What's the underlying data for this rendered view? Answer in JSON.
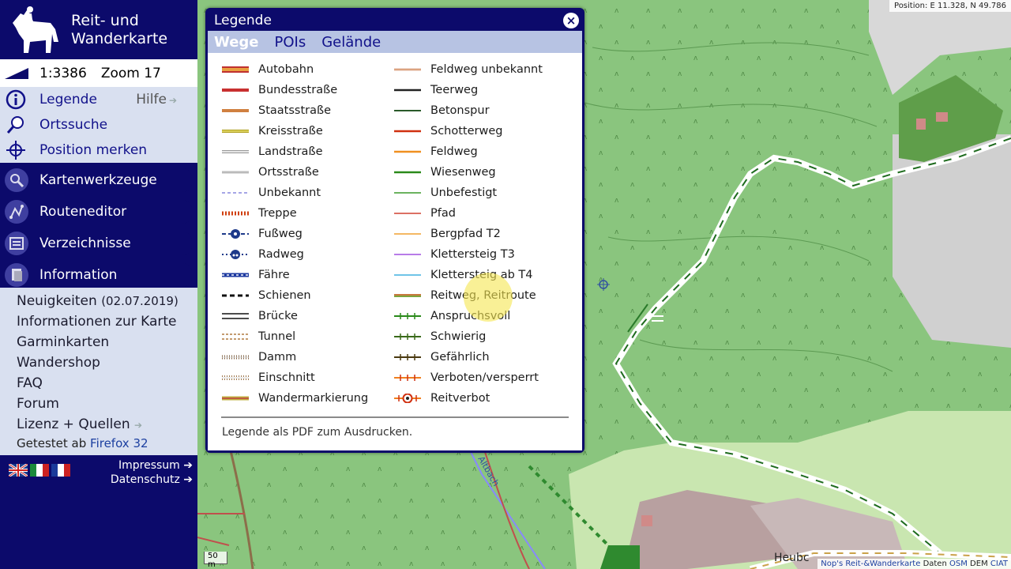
{
  "app": {
    "title_line1": "Reit- und",
    "title_line2": "Wanderkarte"
  },
  "scale": {
    "ratio": "1:3386",
    "zoom": "Zoom 17"
  },
  "menu": {
    "legend": "Legende",
    "help": "Hilfe",
    "search": "Ortssuche",
    "position": "Position merken"
  },
  "sections": {
    "tools": "Kartenwerkzeuge",
    "route": "Routeneditor",
    "dirs": "Verzeichnisse",
    "info": "Information"
  },
  "info_items": {
    "news": "Neuigkeiten",
    "news_date": "(02.07.2019)",
    "map_info": "Informationen zur Karte",
    "garmin": "Garminkarten",
    "shop": "Wandershop",
    "faq": "FAQ",
    "forum": "Forum",
    "license": "Lizenz + Quellen",
    "tested": "Getestet ab",
    "firefox": "Firefox 32"
  },
  "footer": {
    "impressum": "Impressum",
    "datenschutz": "Datenschutz"
  },
  "map": {
    "position": "Position: E 11.328, N 49.786",
    "scale_label": "50 m",
    "attribution": "Nop's Reit-&Wanderkarte",
    "attr_data": "Daten",
    "attr_osm": "OSM",
    "attr_dem": "DEM",
    "attr_ciat": "CIAT",
    "place_label": "Heubc",
    "stream_label": "Altbach"
  },
  "legend": {
    "title": "Legende",
    "close": "×",
    "tabs": [
      "Wege",
      "POIs",
      "Gelände"
    ],
    "left": [
      {
        "label": "Autobahn",
        "style": "autobahn"
      },
      {
        "label": "Bundesstraße",
        "style": "bundes"
      },
      {
        "label": "Staatsstraße",
        "style": "staats"
      },
      {
        "label": "Kreisstraße",
        "style": "kreis"
      },
      {
        "label": "Landstraße",
        "style": "land"
      },
      {
        "label": "Ortsstraße",
        "style": "orts"
      },
      {
        "label": "Unbekannt",
        "style": "unbekannt"
      },
      {
        "label": "Treppe",
        "style": "treppe"
      },
      {
        "label": "Fußweg",
        "style": "fussweg"
      },
      {
        "label": "Radweg",
        "style": "radweg"
      },
      {
        "label": "Fähre",
        "style": "faehre"
      },
      {
        "label": "Schienen",
        "style": "schienen"
      },
      {
        "label": "Brücke",
        "style": "bruecke"
      },
      {
        "label": "Tunnel",
        "style": "tunnel"
      },
      {
        "label": "Damm",
        "style": "damm"
      },
      {
        "label": "Einschnitt",
        "style": "einschnitt"
      },
      {
        "label": "Wandermarkierung",
        "style": "wander"
      }
    ],
    "right": [
      {
        "label": "Feldweg unbekannt",
        "style": "feldunb"
      },
      {
        "label": "Teerweg",
        "style": "teer"
      },
      {
        "label": "Betonspur",
        "style": "beton"
      },
      {
        "label": "Schotterweg",
        "style": "schotter"
      },
      {
        "label": "Feldweg",
        "style": "feld"
      },
      {
        "label": "Wiesenweg",
        "style": "wiesen"
      },
      {
        "label": "Unbefestigt",
        "style": "unbef"
      },
      {
        "label": "Pfad",
        "style": "pfad"
      },
      {
        "label": "Bergpfad T2",
        "style": "berg"
      },
      {
        "label": "Klettersteig T3",
        "style": "kl3"
      },
      {
        "label": "Klettersteig ab T4",
        "style": "kl4"
      },
      {
        "label": "Reitweg, Reitroute",
        "style": "reit"
      },
      {
        "label": "Anspruchsvoll",
        "style": "ansp"
      },
      {
        "label": "Schwierig",
        "style": "schw"
      },
      {
        "label": "Gefährlich",
        "style": "gef"
      },
      {
        "label": "Verboten/versperrt",
        "style": "verb"
      },
      {
        "label": "Reitverbot",
        "style": "reitverbot"
      }
    ],
    "footer_text": "Legende als PDF",
    "footer_suffix": "zum Ausdrucken."
  },
  "colors": {
    "sidebar": "#0c0a6b",
    "panel": "#d9e0f0",
    "forest": "#8ac57e",
    "meadow": "#c9e6b0"
  }
}
